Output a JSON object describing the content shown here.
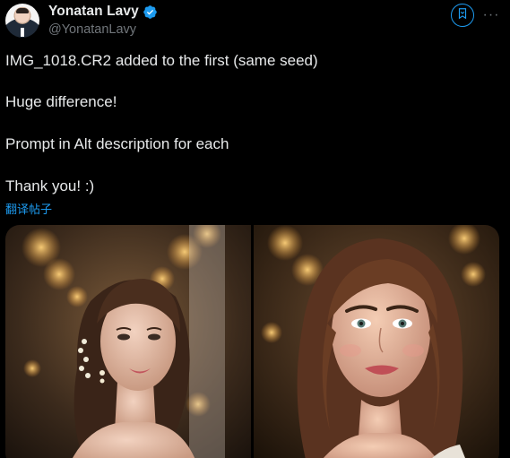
{
  "author": {
    "name": "Yonatan Lavy",
    "handle": "@YonatanLavy",
    "verified": true
  },
  "actions": {
    "bookmark_icon": "bookmark-icon",
    "more_icon": "more-icon",
    "more_glyph": "···"
  },
  "post": {
    "lines": [
      "IMG_1018.CR2 added to the first (same seed)",
      "Huge difference!",
      "Prompt in Alt description for each",
      "Thank you! :)"
    ],
    "translate_label": "翻译帖子"
  },
  "media": {
    "images": [
      {
        "icon": "photo-woman-updo-veil"
      },
      {
        "icon": "photo-woman-wavy-hair"
      }
    ]
  },
  "colors": {
    "background": "#000000",
    "text": "#e7e9ea",
    "secondary": "#71767b",
    "accent": "#1d9bf0"
  }
}
